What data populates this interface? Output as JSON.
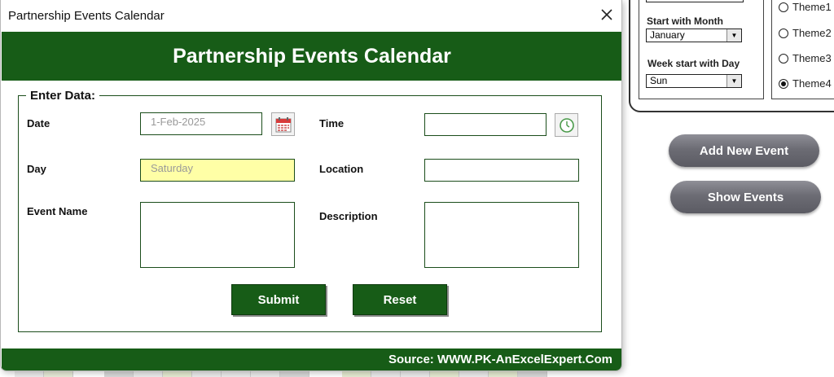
{
  "dialog": {
    "window_title": "Partnership Events Calendar",
    "banner_title": "Partnership Events Calendar",
    "section_label": "Enter Data:",
    "labels": {
      "date": "Date",
      "time": "Time",
      "day": "Day",
      "location": "Location",
      "event_name": "Event Name",
      "description": "Description"
    },
    "values": {
      "date": "1-Feb-2025",
      "time": "",
      "day": "Saturday",
      "location": "",
      "event_name": "",
      "description": ""
    },
    "buttons": {
      "submit": "Submit",
      "reset": "Reset"
    },
    "footer": "Source: WWW.PK-AnExcelExpert.Com"
  },
  "sheet": {
    "settings": {
      "start_month_label": "Start with Month",
      "start_month_value": "January",
      "week_start_label": "Week start with Day",
      "week_start_value": "Sun"
    },
    "themes": [
      {
        "label": "Theme1",
        "checked": false
      },
      {
        "label": "Theme2",
        "checked": false
      },
      {
        "label": "Theme3",
        "checked": false
      },
      {
        "label": "Theme4",
        "checked": true
      }
    ],
    "buttons": {
      "add_event": "Add New Event",
      "show_events": "Show Events"
    }
  },
  "colors": {
    "brand_green": "#175c17",
    "day_field_bg": "#ffffa6",
    "pill_button": "#6c6c74"
  },
  "icons": {
    "calendar": "calendar-icon",
    "clock": "clock-icon",
    "close": "close-icon"
  }
}
